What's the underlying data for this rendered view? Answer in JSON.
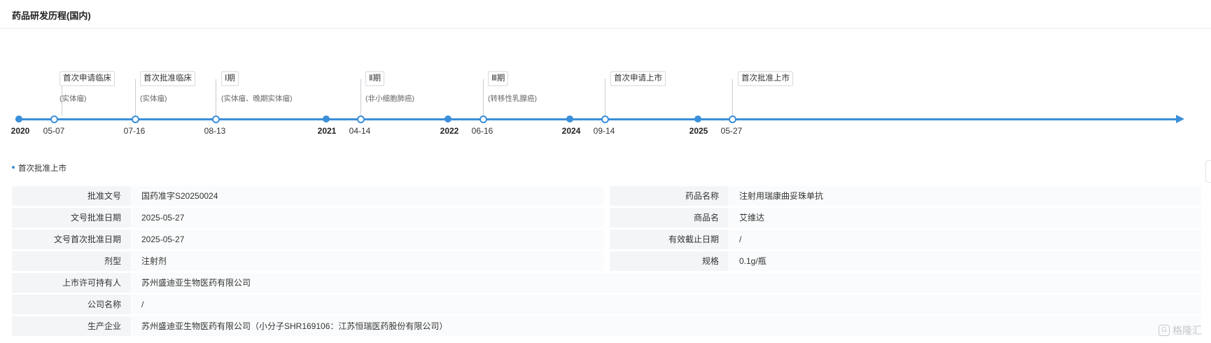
{
  "page": {
    "title": "药品研发历程(国内)"
  },
  "timeline": {
    "years": [
      {
        "label": "2020"
      },
      {
        "label": "2021"
      },
      {
        "label": "2022"
      },
      {
        "label": "2024"
      },
      {
        "label": "2025"
      }
    ],
    "events": [
      {
        "date": "05-07",
        "label": "首次申请临床",
        "sub": "(实体瘤)"
      },
      {
        "date": "07-16",
        "label": "首次批准临床",
        "sub": "(实体瘤)"
      },
      {
        "date": "08-13",
        "label": "Ⅰ期",
        "sub": "(实体瘤、晚期实体瘤)"
      },
      {
        "date": "04-14",
        "label": "Ⅱ期",
        "sub": "(非小细胞肺癌)"
      },
      {
        "date": "06-16",
        "label": "Ⅲ期",
        "sub": "(转移性乳腺癌)"
      },
      {
        "date": "09-14",
        "label": "首次申请上市",
        "sub": ""
      },
      {
        "date": "05-27",
        "label": "首次批准上市",
        "sub": ""
      }
    ]
  },
  "detail": {
    "section_title": "首次批准上市",
    "left_rows": [
      {
        "label": "批准文号",
        "value": "国药准字S20250024"
      },
      {
        "label": "文号批准日期",
        "value": "2025-05-27"
      },
      {
        "label": "文号首次批准日期",
        "value": "2025-05-27"
      },
      {
        "label": "剂型",
        "value": "注射剂"
      }
    ],
    "right_rows": [
      {
        "label": "药品名称",
        "value": "注射用瑞康曲妥珠单抗"
      },
      {
        "label": "商品名",
        "value": "艾维达"
      },
      {
        "label": "有效截止日期",
        "value": "/"
      },
      {
        "label": "规格",
        "value": "0.1g/瓶"
      }
    ],
    "full_rows": [
      {
        "label": "上市许可持有人",
        "value": "苏州盛迪亚生物医药有限公司"
      },
      {
        "label": "公司名称",
        "value": "/"
      },
      {
        "label": "生产企业",
        "value": "苏州盛迪亚生物医药有限公司（小分子SHR169106：江苏恒瑞医药股份有限公司）"
      }
    ]
  },
  "watermark": {
    "logo": "G",
    "text": "格隆汇"
  },
  "colors": {
    "accent": "#3b8fd9"
  }
}
